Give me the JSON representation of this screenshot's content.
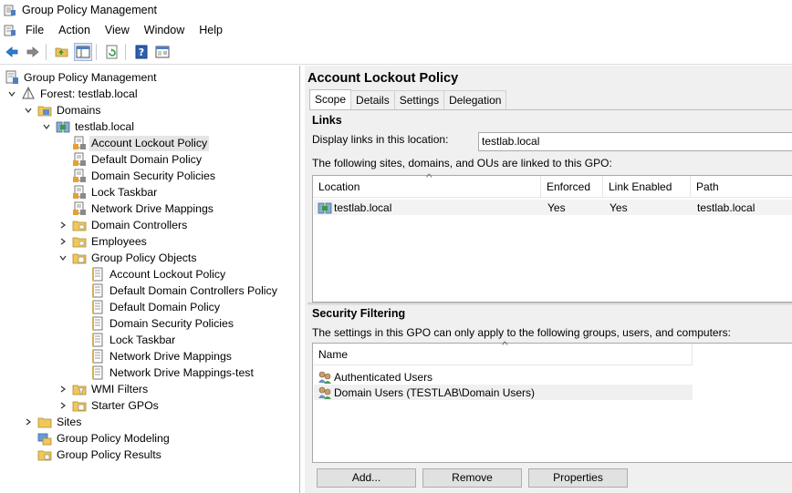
{
  "window": {
    "title": "Group Policy Management"
  },
  "menu": [
    "File",
    "Action",
    "View",
    "Window",
    "Help"
  ],
  "toolbar": {
    "icons": [
      "back-arrow-icon",
      "forward-arrow-icon",
      "up-folder-icon",
      "show-hide-tree-icon",
      "refresh-icon",
      "help-icon",
      "properties-icon"
    ]
  },
  "tree": {
    "root": "Group Policy Management",
    "forest": "Forest: testlab.local",
    "domains": "Domains",
    "domain": "testlab.local",
    "links": [
      "Account Lockout Policy",
      "Default Domain Policy",
      "Domain Security Policies",
      "Lock Taskbar",
      "Network Drive Mappings"
    ],
    "ous": [
      "Domain Controllers",
      "Employees"
    ],
    "gpo_container": "Group Policy Objects",
    "gpos": [
      "Account Lockout Policy",
      "Default Domain Controllers Policy",
      "Default Domain Policy",
      "Domain Security Policies",
      "Lock Taskbar",
      "Network Drive Mappings",
      "Network Drive Mappings-test"
    ],
    "wmi": "WMI Filters",
    "starter": "Starter GPOs",
    "sites": "Sites",
    "modeling": "Group Policy Modeling",
    "results": "Group Policy Results"
  },
  "detail": {
    "title": "Account Lockout Policy",
    "tabs": [
      "Scope",
      "Details",
      "Settings",
      "Delegation"
    ],
    "links_title": "Links",
    "display_links_label": "Display links in this location:",
    "display_links_value": "testlab.local",
    "linked_text": "The following sites, domains, and OUs are linked to this GPO:",
    "links_columns": [
      "Location",
      "Enforced",
      "Link Enabled",
      "Path"
    ],
    "links_rows": [
      {
        "location": "testlab.local",
        "enforced": "Yes",
        "link_enabled": "Yes",
        "path": "testlab.local"
      }
    ],
    "security_title": "Security Filtering",
    "security_text": "The settings in this GPO can only apply to the following groups, users, and computers:",
    "security_column": "Name",
    "security_rows": [
      "Authenticated Users",
      "Domain Users (TESTLAB\\Domain Users)"
    ],
    "buttons": {
      "add": "Add...",
      "remove": "Remove",
      "properties": "Properties"
    }
  }
}
